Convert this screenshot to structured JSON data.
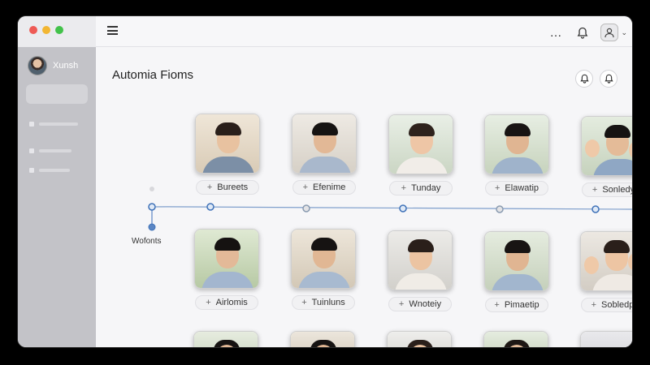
{
  "window": {
    "traffic_lights": [
      "#ee5a55",
      "#f2b632",
      "#42c24a"
    ]
  },
  "sidebar": {
    "profile_name": "Xunsh"
  },
  "topbar": {
    "more_icon": "…",
    "bell_icon": "🔔",
    "chevron_icon": "⌄"
  },
  "main": {
    "title": "Automia Fioms"
  },
  "timeline": {
    "label": "Wofonts"
  },
  "rows": [
    {
      "cards": [
        {
          "label": "Bureets"
        },
        {
          "label": "Efenime"
        },
        {
          "label": "Tunday"
        },
        {
          "label": "Elawatip"
        },
        {
          "label": "Sonledy"
        }
      ]
    },
    {
      "cards": [
        {
          "label": "Airlomis"
        },
        {
          "label": "Tuinluns"
        },
        {
          "label": "Wnoteiy"
        },
        {
          "label": "Pimaetip"
        },
        {
          "label": "Sobledp"
        }
      ]
    }
  ],
  "colors": {
    "accent": "#4a7fc1",
    "sidebar_bg": "#c3c3c8",
    "content_bg": "#f6f6f8"
  }
}
